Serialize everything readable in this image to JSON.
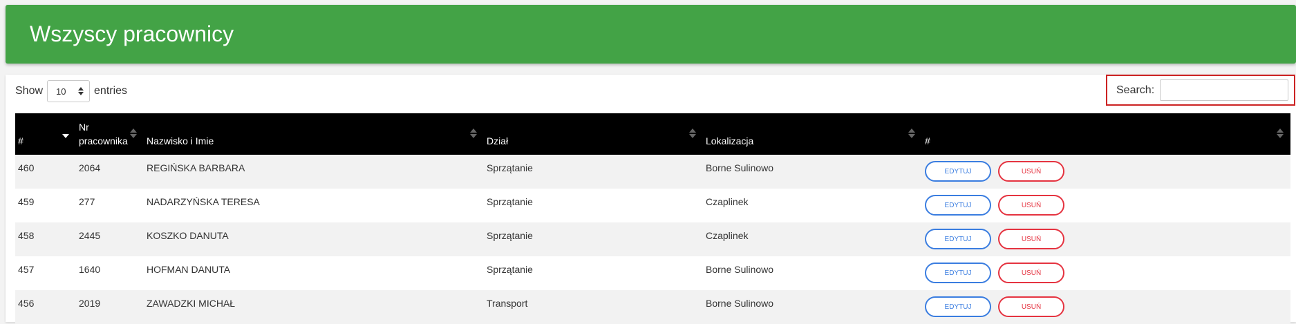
{
  "header": {
    "title": "Wszyscy pracownicy"
  },
  "controls": {
    "show_label": "Show",
    "entries_value": "10",
    "entries_label": "entries",
    "search_label": "Search:",
    "search_value": ""
  },
  "table": {
    "columns": [
      {
        "label": "#"
      },
      {
        "label": "Nr pracownika"
      },
      {
        "label": "Nazwisko i Imie"
      },
      {
        "label": "Dział"
      },
      {
        "label": "Lokalizacja"
      },
      {
        "label": "#"
      }
    ],
    "rows": [
      {
        "id": "460",
        "nr": "2064",
        "name": "REGIŃSKA BARBARA",
        "dept": "Sprzątanie",
        "loc": "Borne Sulinowo"
      },
      {
        "id": "459",
        "nr": "277",
        "name": "NADARZYŃSKA TERESA",
        "dept": "Sprzątanie",
        "loc": "Czaplinek"
      },
      {
        "id": "458",
        "nr": "2445",
        "name": "KOSZKO DANUTA",
        "dept": "Sprzątanie",
        "loc": "Czaplinek"
      },
      {
        "id": "457",
        "nr": "1640",
        "name": "HOFMAN DANUTA",
        "dept": "Sprzątanie",
        "loc": "Borne Sulinowo"
      },
      {
        "id": "456",
        "nr": "2019",
        "name": "ZAWADZKI MICHAŁ",
        "dept": "Transport",
        "loc": "Borne Sulinowo"
      }
    ],
    "edit_label": "EDYTUJ",
    "delete_label": "USUŃ"
  },
  "colors": {
    "header_bg": "#43a346",
    "table_header_bg": "#000000",
    "edit_accent": "#3a7de0",
    "delete_accent": "#e53340",
    "highlight_box": "#cc2222"
  }
}
